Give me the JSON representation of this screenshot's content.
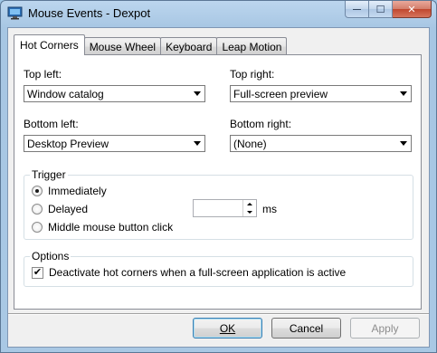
{
  "window": {
    "title": "Mouse Events - Dexpot"
  },
  "tabs": [
    {
      "label": "Hot Corners",
      "active": true
    },
    {
      "label": "Mouse Wheel",
      "active": false
    },
    {
      "label": "Keyboard",
      "active": false
    },
    {
      "label": "Leap Motion",
      "active": false
    }
  ],
  "corners": {
    "top_left": {
      "label": "Top left:",
      "value": "Window catalog"
    },
    "top_right": {
      "label": "Top right:",
      "value": "Full-screen preview"
    },
    "bottom_left": {
      "label": "Bottom left:",
      "value": "Desktop Preview"
    },
    "bottom_right": {
      "label": "Bottom right:",
      "value": "(None)"
    }
  },
  "trigger": {
    "legend": "Trigger",
    "immediately": "Immediately",
    "delayed": "Delayed",
    "middle_click": "Middle mouse button click",
    "delay_value": "",
    "unit": "ms",
    "selected": "immediately"
  },
  "options": {
    "legend": "Options",
    "deactivate_label": "Deactivate hot corners when a full-screen application is active",
    "deactivate_checked": true,
    "check_glyph": "✔"
  },
  "buttons": {
    "ok": "OK",
    "cancel": "Cancel",
    "apply": "Apply"
  },
  "titlebar": {
    "minimize_glyph": "—",
    "maximize_glyph": "☐",
    "close_glyph": "✕"
  }
}
